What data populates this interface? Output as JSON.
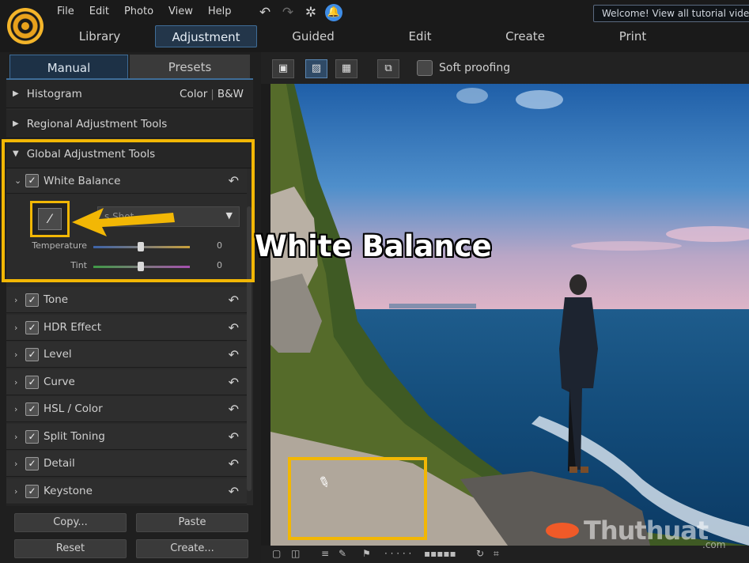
{
  "menu": [
    "File",
    "Edit",
    "Photo",
    "View",
    "Help"
  ],
  "welcome_banner": "Welcome! View all tutorial videos he",
  "modes": [
    "Library",
    "Adjustment",
    "Guided",
    "Edit",
    "Create",
    "Print"
  ],
  "active_mode": "Adjustment",
  "panel_tabs": {
    "manual": "Manual",
    "presets": "Presets"
  },
  "sections": {
    "histogram": "Histogram",
    "histogram_color": "Color",
    "histogram_bw": "B&W",
    "regional": "Regional Adjustment Tools",
    "global": "Global Adjustment Tools"
  },
  "white_balance": {
    "label": "White Balance",
    "preset": "s Shot",
    "temperature_label": "Temperature",
    "temperature_value": "0",
    "tint_label": "Tint",
    "tint_value": "0"
  },
  "tools": [
    "Tone",
    "HDR Effect",
    "Level",
    "Curve",
    "HSL / Color",
    "Split Toning",
    "Detail",
    "Keystone"
  ],
  "buttons": {
    "copy": "Copy...",
    "paste": "Paste",
    "reset": "Reset",
    "create": "Create..."
  },
  "view_toolbar": {
    "soft_proofing": "Soft proofing"
  },
  "caption": "White Balance",
  "watermark": {
    "text": "Thuthuat",
    "suffix": ".com"
  },
  "icons": {
    "undo": "undo-icon",
    "redo": "redo-icon",
    "settings": "gear-icon",
    "notifications": "bell-icon",
    "eyedropper": "eyedropper-icon",
    "reset_item": "reset-arrow-icon"
  },
  "colors": {
    "highlight": "#f2b705",
    "accent_blue": "#3f6d98"
  }
}
